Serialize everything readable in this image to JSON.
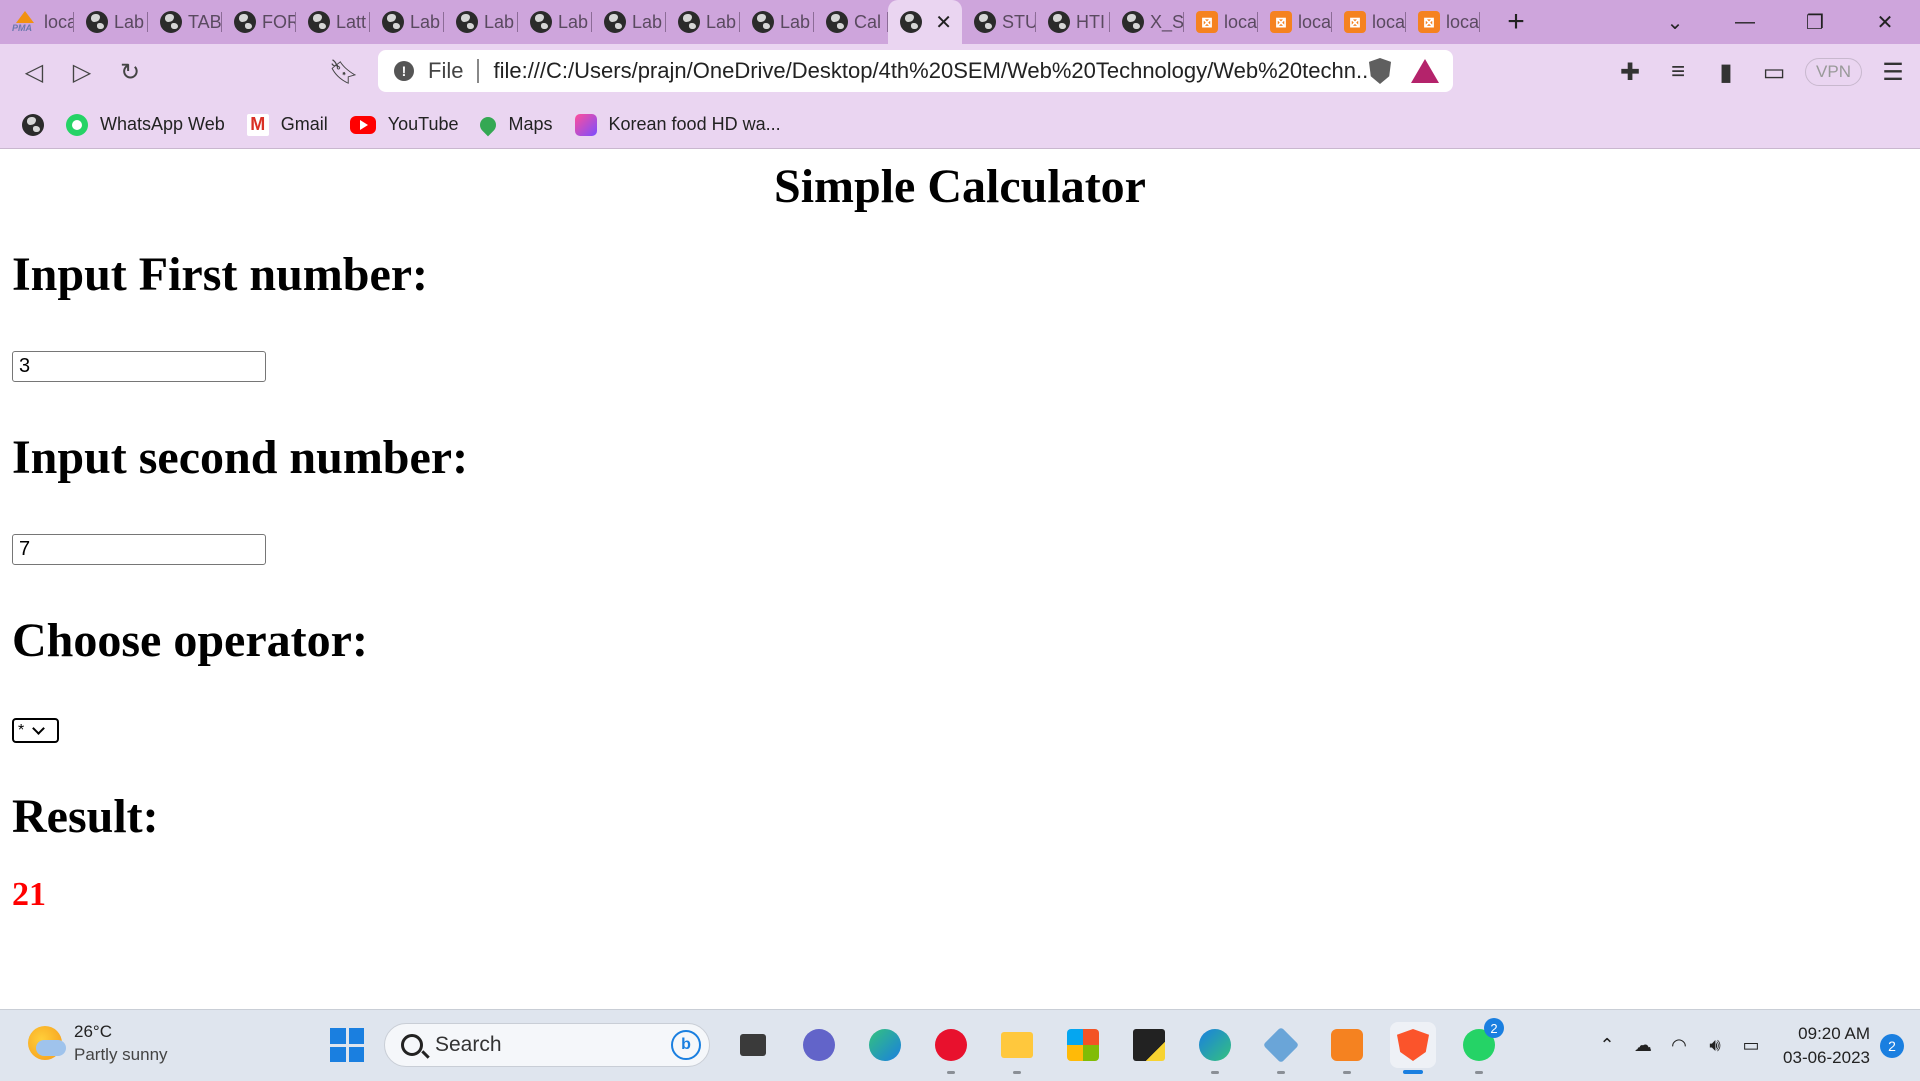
{
  "browser": {
    "tabs": [
      {
        "label": "loca",
        "icon": "phpmyadmin-icon"
      },
      {
        "label": "Lab",
        "icon": "globe-icon"
      },
      {
        "label": "TAB",
        "icon": "globe-icon"
      },
      {
        "label": "FOR",
        "icon": "globe-icon"
      },
      {
        "label": "Latt",
        "icon": "globe-icon"
      },
      {
        "label": "Lab",
        "icon": "globe-icon"
      },
      {
        "label": "Lab",
        "icon": "globe-icon"
      },
      {
        "label": "Lab",
        "icon": "globe-icon"
      },
      {
        "label": "Lab",
        "icon": "globe-icon"
      },
      {
        "label": "Lab",
        "icon": "globe-icon"
      },
      {
        "label": "Lab",
        "icon": "globe-icon"
      },
      {
        "label": "Cal",
        "icon": "globe-icon"
      },
      {
        "label": "",
        "icon": "globe-icon",
        "active": true
      },
      {
        "label": "STU",
        "icon": "globe-icon"
      },
      {
        "label": "HTI",
        "icon": "globe-icon"
      },
      {
        "label": "X_S",
        "icon": "globe-icon"
      },
      {
        "label": "loca",
        "icon": "xampp-icon"
      },
      {
        "label": "loca",
        "icon": "xampp-icon"
      },
      {
        "label": "loca",
        "icon": "xampp-icon"
      },
      {
        "label": "loca",
        "icon": "xampp-icon"
      }
    ],
    "address": {
      "scheme_label": "File",
      "url": "file:///C:/Users/prajn/OneDrive/Desktop/4th%20SEM/Web%20Technology/Web%20techn..."
    },
    "vpn_label": "VPN",
    "bookmarks": [
      {
        "label": "",
        "icon": "globe-icon"
      },
      {
        "label": "WhatsApp Web",
        "icon": "whatsapp-icon"
      },
      {
        "label": "Gmail",
        "icon": "gmail-icon"
      },
      {
        "label": "YouTube",
        "icon": "youtube-icon"
      },
      {
        "label": "Maps",
        "icon": "maps-icon"
      },
      {
        "label": "Korean food HD wa...",
        "icon": "kfood-icon"
      }
    ]
  },
  "page": {
    "title": "Simple Calculator",
    "first_label": "Input First number:",
    "first_value": "3",
    "second_label": "Input second number:",
    "second_value": "7",
    "operator_label": "Choose operator:",
    "operator_value": "*",
    "result_label": "Result:",
    "result_value": "21",
    "result_color": "#ff0000"
  },
  "taskbar": {
    "weather_temp": "26°C",
    "weather_desc": "Partly sunny",
    "search_placeholder": "Search",
    "whatsapp_badge": "2",
    "time": "09:20 AM",
    "date": "03-06-2023",
    "notification_count": "2"
  },
  "colors": {
    "tabstrip": "#cea5dc",
    "toolbar": "#ead5f1",
    "taskbar": "#dfe5ee"
  }
}
